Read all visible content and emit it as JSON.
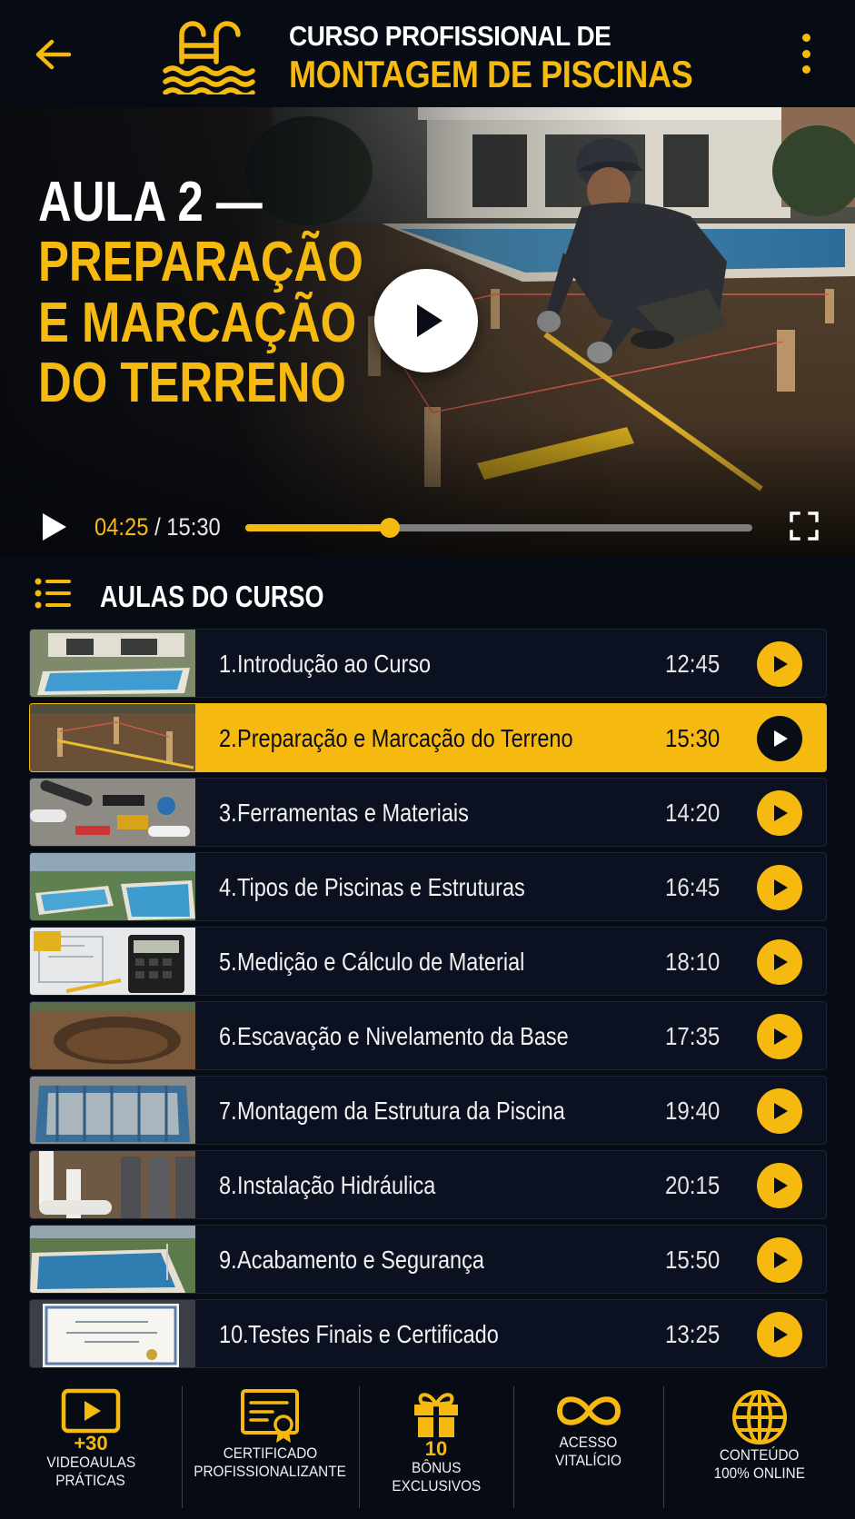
{
  "header": {
    "title_line1": "CURSO PROFISSIONAL DE",
    "title_line2": "MONTAGEM DE PISCINAS",
    "back_icon": "arrow-left-icon",
    "menu_icon": "more-vertical-icon",
    "logo_icon": "pool-ladder-waves-icon"
  },
  "video": {
    "title_line1": "AULA 2 —",
    "title_line2": "PREPARAÇÃO",
    "title_line3": "E MARCAÇÃO",
    "title_line4": "DO TERRENO",
    "current_time": "04:25",
    "separator": "/",
    "duration": "15:30",
    "progress_fraction": 0.285
  },
  "lessons_section": {
    "title": "AULAS DO CURSO"
  },
  "lessons": [
    {
      "num": "1.",
      "title": "Introdução ao Curso",
      "duration": "12:45",
      "active": false,
      "thumb": "pool-house"
    },
    {
      "num": "2.",
      "title": "Preparação e Marcação do Terreno",
      "duration": "15:30",
      "active": true,
      "thumb": "terrain-marking"
    },
    {
      "num": "3.",
      "title": "Ferramentas e Materiais",
      "duration": "14:20",
      "active": false,
      "thumb": "tools"
    },
    {
      "num": "4.",
      "title": "Tipos de Piscinas e Estruturas",
      "duration": "16:45",
      "active": false,
      "thumb": "pool-types"
    },
    {
      "num": "5.",
      "title": "Medição e Cálculo de Material",
      "duration": "18:10",
      "active": false,
      "thumb": "calculator-plans"
    },
    {
      "num": "6.",
      "title": "Escavação e Nivelamento da Base",
      "duration": "17:35",
      "active": false,
      "thumb": "excavation"
    },
    {
      "num": "7.",
      "title": "Montagem da Estrutura da Piscina",
      "duration": "19:40",
      "active": false,
      "thumb": "pool-frame"
    },
    {
      "num": "8.",
      "title": "Instalação Hidráulica",
      "duration": "20:15",
      "active": false,
      "thumb": "pipes"
    },
    {
      "num": "9.",
      "title": "Acabamento e Segurança",
      "duration": "15:50",
      "active": false,
      "thumb": "finished-pool"
    },
    {
      "num": "10.",
      "title": "Testes Finais e Certificado",
      "duration": "13:25",
      "active": false,
      "thumb": "certificate"
    }
  ],
  "features": [
    {
      "icon": "video-play-icon",
      "number": "+30",
      "line1": "VIDEOAULAS",
      "line2": "PRÁTICAS"
    },
    {
      "icon": "certificate-icon",
      "number": "",
      "line1": "CERTIFICADO",
      "line2": "PROFISSIONALIZANTE"
    },
    {
      "icon": "gift-icon",
      "number": "10",
      "line1": "BÔNUS",
      "line2": "EXCLUSIVOS"
    },
    {
      "icon": "infinity-icon",
      "number": "",
      "line1": "ACESSO",
      "line2": "VITALÍCIO"
    },
    {
      "icon": "globe-icon",
      "number": "",
      "line1": "CONTEÚDO",
      "line2": "100% ONLINE"
    }
  ],
  "colors": {
    "accent": "#f5b90f",
    "background": "#070b14",
    "card": "#0b1120"
  }
}
